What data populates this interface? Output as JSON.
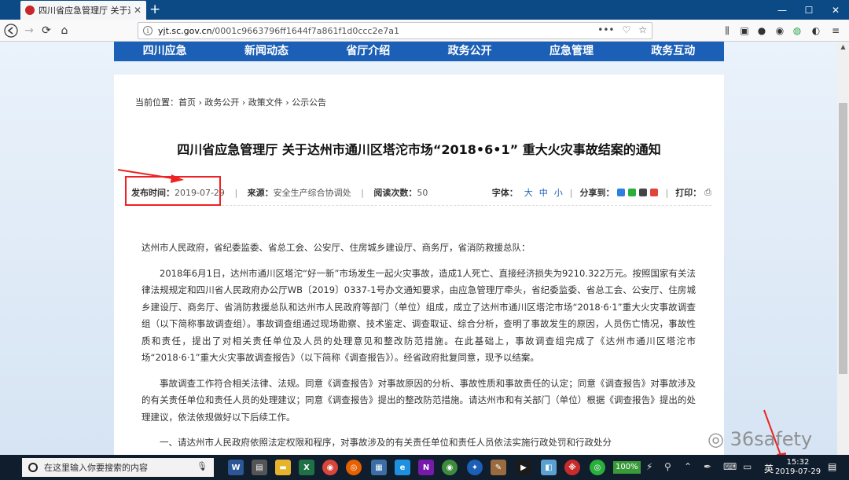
{
  "browser": {
    "tab_title": "四川省应急管理厅 关于达州市",
    "url_scheme": "https://",
    "url_host": "yjt.sc.gov.cn",
    "url_path": "/0001c9663796ff1644f7a861f1d0ccc2e7a1",
    "url_menu": "•••"
  },
  "site_nav": {
    "items": [
      "四川应急",
      "新闻动态",
      "省厅介绍",
      "政务公开",
      "应急管理",
      "政务互动"
    ]
  },
  "breadcrumb": "当前位置：首页 › 政务公开 › 政策文件 › 公示公告",
  "article": {
    "title": "四川省应急管理厅 关于达州市通川区塔沱市场“2018•6•1” 重大火灾事故结案的通知",
    "publish_label": "发布时间：",
    "publish_date": "2019-07-29",
    "source_label": "来源：",
    "source": "安全生产综合协调处",
    "reads_label": "阅读次数：",
    "reads": "50",
    "font_label": "字体：",
    "font_large": "大",
    "font_medium": "中",
    "font_small": "小",
    "share_label": "分享到：",
    "print_label": "打印：",
    "paragraphs": [
      "达州市人民政府，省纪委监委、省总工会、公安厅、住房城乡建设厅、商务厅，省消防救援总队：",
      "2018年6月1日，达州市通川区塔沱“好一新”市场发生一起火灾事故，造成1人死亡、直接经济损失为9210.322万元。按照国家有关法律法规规定和四川省人民政府办公厅WB〔2019〕0337-1号办文通知要求，由应急管理厅牵头，省纪委监委、省总工会、公安厅、住房城乡建设厅、商务厅、省消防救援总队和达州市人民政府等部门（单位）组成，成立了达州市通川区塔沱市场“2018·6·1”重大火灾事故调查组（以下简称事故调查组）。事故调查组通过现场勘察、技术鉴定、调查取证、综合分析，查明了事故发生的原因，人员伤亡情况，事故性质和责任，提出了对相关责任单位及人员的处理意见和整改防范措施。在此基础上，事故调查组完成了《达州市通川区塔沱市场“2018·6·1”重大火灾事故调查报告》（以下简称《调查报告》）。经省政府批复同意，现予以结案。",
      "事故调查工作符合相关法律、法规。同意《调查报告》对事故原因的分析、事故性质和事故责任的认定；同意《调查报告》对事故涉及的有关责任单位和责任人员的处理建议；同意《调查报告》提出的整改防范措施。请达州市和有关部门（单位）根据《调查报告》提出的处理建议，依法依规做好以下后续工作。",
      "一、请达州市人民政府依照法定权限和程序，对事故涉及的有关责任单位和责任人员依法实施行政处罚和行政处分"
    ]
  },
  "watermark": "36safety",
  "taskbar": {
    "search_placeholder": "在这里输入你要搜索的内容",
    "battery": "100%",
    "ime": "英",
    "time": "15:32",
    "date": "2019-07-29"
  },
  "colors": {
    "nav_blue": "#1b5fb6",
    "annotation_red": "#e22",
    "titlebar": "#0c4a86"
  }
}
